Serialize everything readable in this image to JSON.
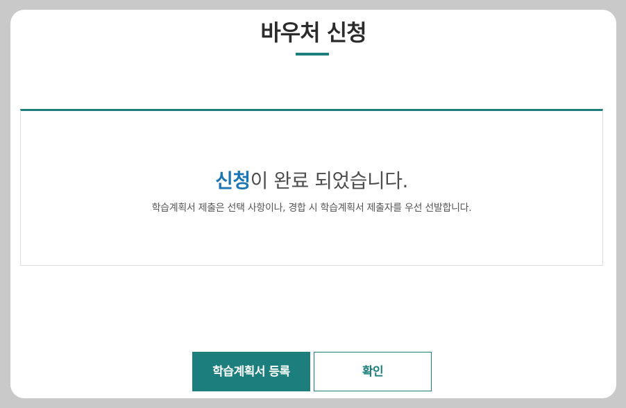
{
  "dialog": {
    "title": "바우처 신청"
  },
  "result": {
    "heading_highlight": "신청",
    "heading_rest": "이 완료 되었습니다.",
    "note": "학습계획서 제출은 선택 사항이나, 경합 시 학습계획서 제출자를 우선 선발합니다."
  },
  "buttons": {
    "register_plan": "학습계획서 등록",
    "confirm": "확인"
  },
  "colors": {
    "accent": "#1c7f7e",
    "highlight": "#1b74b6",
    "backdrop": "#c9c9c9"
  }
}
